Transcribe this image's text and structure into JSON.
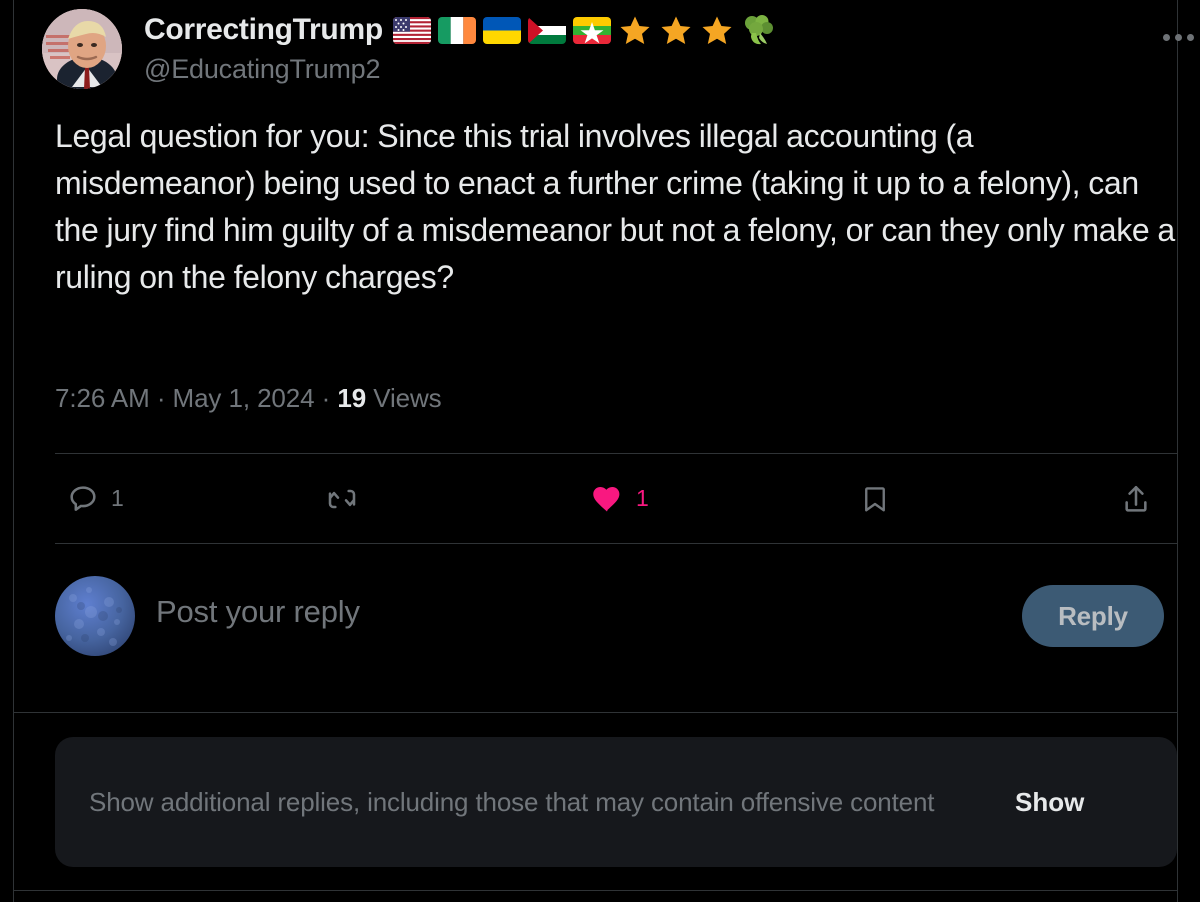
{
  "post": {
    "author": {
      "display_name": "CorrectingTrump",
      "handle": "@EducatingTrump2",
      "avatar_name": "trump-mugshot-avatar",
      "name_emojis": [
        {
          "name": "flag-united-states",
          "glyph": "🇺🇸"
        },
        {
          "name": "flag-ireland",
          "glyph": "🇮🇪"
        },
        {
          "name": "flag-ukraine",
          "glyph": "🇺🇦"
        },
        {
          "name": "flag-palestine",
          "glyph": "🇵🇸"
        },
        {
          "name": "flag-myanmar",
          "glyph": "🇲🇲"
        },
        {
          "name": "star-1",
          "glyph": "⭐"
        },
        {
          "name": "star-2",
          "glyph": "⭐"
        },
        {
          "name": "star-3",
          "glyph": "⭐"
        },
        {
          "name": "broccoli",
          "glyph": "🥦"
        }
      ]
    },
    "text": "Legal question for you:\nSince this trial involves illegal accounting (a misdemeanor) being used to enact a further crime (taking it up to a felony), can the jury find him guilty of a misdemeanor but not a felony, or can they only make a ruling on the felony charges?",
    "time": "7:26 AM",
    "date": "May 1, 2024",
    "separator": "·",
    "views_count": "19",
    "views_label": "Views",
    "actions": {
      "reply": {
        "icon": "reply-icon",
        "count": "1"
      },
      "retweet": {
        "icon": "retweet-icon",
        "count": ""
      },
      "like": {
        "icon": "heart-icon-filled",
        "count": "1",
        "color": "#f91880"
      },
      "bookmark": {
        "icon": "bookmark-icon",
        "count": ""
      },
      "share": {
        "icon": "share-icon",
        "count": ""
      }
    },
    "more_menu_icon": "more-horizontal-icon"
  },
  "composer": {
    "avatar_name": "blue-texture-avatar",
    "placeholder": "Post your reply",
    "reply_label": "Reply"
  },
  "offensive_notice": {
    "text": "Show additional replies, including those that may contain offensive content",
    "action_label": "Show"
  },
  "colors": {
    "background": "#000000",
    "text_primary": "#e7e9ea",
    "text_secondary": "#71767b",
    "border": "#2f3336",
    "like_pink": "#f91880",
    "reply_button_bg": "#3c5a74",
    "card_bg": "#16181c"
  }
}
